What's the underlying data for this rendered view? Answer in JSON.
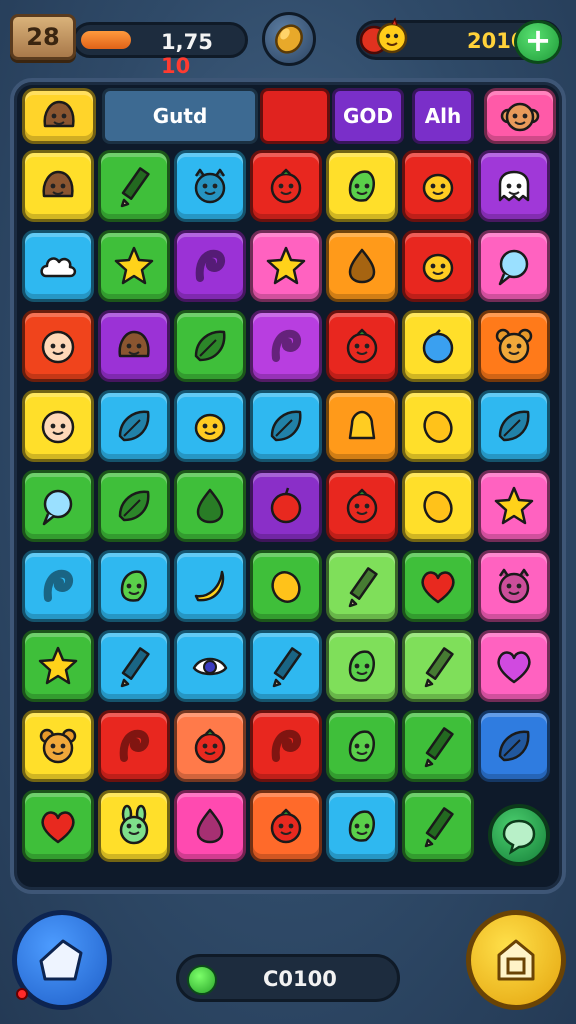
{
  "hud": {
    "level_label": "28",
    "energy_label_main": "1,75",
    "energy_label_accent": "10",
    "energy_level": 0.6,
    "score_label": "2010",
    "plus_label": "+"
  },
  "tabs": [
    {
      "label": "Gutd",
      "color": "#3d6a92",
      "text_color": "#ffffff"
    },
    {
      "label": "",
      "color": "#e0231f",
      "text_color": "#ffffff"
    },
    {
      "label": "GOD",
      "color": "#7a2fc9",
      "text_color": "#ffffff"
    },
    {
      "label": "Alh",
      "color": "#7a2fc9",
      "text_color": "#ffffff"
    }
  ],
  "tab_icons": [
    {
      "icon": "blob-face-icon",
      "color": "#ffd42a"
    },
    {
      "icon": "monkey-face-icon",
      "color": "#ff5aa8"
    }
  ],
  "grid": [
    [
      {
        "icon": "blob-face-icon",
        "bg": "#ffdf2a"
      },
      {
        "icon": "pencil-icon",
        "bg": "#3fbf3a"
      },
      {
        "icon": "cat-face-icon",
        "bg": "#2fb8f0"
      },
      {
        "icon": "tomato-face-icon",
        "bg": "#e8271f"
      },
      {
        "icon": "leaf-face-icon",
        "bg": "#ffdf2a"
      },
      {
        "icon": "lemon-face-icon",
        "bg": "#e8271f"
      },
      {
        "icon": "ghost-face-icon",
        "bg": "#a038d8"
      }
    ],
    [
      {
        "icon": "cloud-icon",
        "bg": "#2fb8f0"
      },
      {
        "icon": "star-icon",
        "bg": "#3fbf3a"
      },
      {
        "icon": "swirl-icon",
        "bg": "#9b32d6"
      },
      {
        "icon": "star-icon",
        "bg": "#ff62c0"
      },
      {
        "icon": "drop-icon",
        "bg": "#ff9a1a"
      },
      {
        "icon": "lemon-face-icon",
        "bg": "#e8271f"
      },
      {
        "icon": "bubble-icon",
        "bg": "#ff62c0"
      }
    ],
    [
      {
        "icon": "smile-face-icon",
        "bg": "#f0441c"
      },
      {
        "icon": "blob-face-icon",
        "bg": "#9b32d6"
      },
      {
        "icon": "leaf-icon",
        "bg": "#3fbf3a"
      },
      {
        "icon": "swirl-icon",
        "bg": "#b83ee0"
      },
      {
        "icon": "tomato-face-icon",
        "bg": "#e8271f"
      },
      {
        "icon": "berry-icon",
        "bg": "#ffdf2a"
      },
      {
        "icon": "bear-face-icon",
        "bg": "#ff7a1a"
      }
    ],
    [
      {
        "icon": "smile-face-icon",
        "bg": "#ffdf2a"
      },
      {
        "icon": "leaf-icon",
        "bg": "#2fb8f0"
      },
      {
        "icon": "lemon-face-icon",
        "bg": "#2fb8f0"
      },
      {
        "icon": "leaf-icon",
        "bg": "#2fb8f0"
      },
      {
        "icon": "bell-icon",
        "bg": "#ff9a1a"
      },
      {
        "icon": "lemon-icon",
        "bg": "#ffdf2a"
      },
      {
        "icon": "leaf-icon",
        "bg": "#2fb8f0"
      }
    ],
    [
      {
        "icon": "bubble-icon",
        "bg": "#3fbf3a"
      },
      {
        "icon": "leaf-icon",
        "bg": "#3fbf3a"
      },
      {
        "icon": "drop-icon",
        "bg": "#3fbf3a"
      },
      {
        "icon": "apple-icon",
        "bg": "#8a2fc8"
      },
      {
        "icon": "tomato-face-icon",
        "bg": "#e8271f"
      },
      {
        "icon": "lemon-icon",
        "bg": "#ffdf2a"
      },
      {
        "icon": "star-icon",
        "bg": "#ff62c0"
      }
    ],
    [
      {
        "icon": "swirl-icon",
        "bg": "#2fb8f0"
      },
      {
        "icon": "leaf-face-icon",
        "bg": "#2fb8f0"
      },
      {
        "icon": "banana-icon",
        "bg": "#2fb8f0"
      },
      {
        "icon": "lemon-icon",
        "bg": "#3fbf3a"
      },
      {
        "icon": "pencil-icon",
        "bg": "#7fdf5a"
      },
      {
        "icon": "heart-icon",
        "bg": "#3fbf3a"
      },
      {
        "icon": "cat-face-icon",
        "bg": "#ff62c0"
      }
    ],
    [
      {
        "icon": "star-icon",
        "bg": "#3fbf3a"
      },
      {
        "icon": "pencil-icon",
        "bg": "#2fb8f0"
      },
      {
        "icon": "eye-icon",
        "bg": "#2fb8f0"
      },
      {
        "icon": "pencil-icon",
        "bg": "#2fb8f0"
      },
      {
        "icon": "leaf-face-icon",
        "bg": "#7fdf5a"
      },
      {
        "icon": "pencil-icon",
        "bg": "#7fdf5a"
      },
      {
        "icon": "heart-icon",
        "bg": "#ff62c0"
      }
    ],
    [
      {
        "icon": "bear-face-icon",
        "bg": "#ffdf2a"
      },
      {
        "icon": "swirl-icon",
        "bg": "#e8271f"
      },
      {
        "icon": "tomato-face-icon",
        "bg": "#ff7a4a"
      },
      {
        "icon": "swirl-icon",
        "bg": "#e8271f"
      },
      {
        "icon": "leaf-face-icon",
        "bg": "#3fbf3a"
      },
      {
        "icon": "pencil-icon",
        "bg": "#3fbf3a"
      },
      {
        "icon": "leaf-icon",
        "bg": "#2f7ce0"
      }
    ],
    [
      {
        "icon": "heart-icon",
        "bg": "#3fbf3a"
      },
      {
        "icon": "bunny-face-icon",
        "bg": "#ffdf2a"
      },
      {
        "icon": "drop-icon",
        "bg": "#ff4ab0"
      },
      {
        "icon": "tomato-face-icon",
        "bg": "#ff6a2a"
      },
      {
        "icon": "leaf-face-icon",
        "bg": "#2fb8f0"
      },
      {
        "icon": "pencil-icon",
        "bg": "#3fbf3a"
      }
    ]
  ],
  "bottom": {
    "progress_label": "C0100",
    "home_icon": "home-icon",
    "shop_icon": "shop-icon",
    "hint_icon": "hint-bubble-icon"
  }
}
